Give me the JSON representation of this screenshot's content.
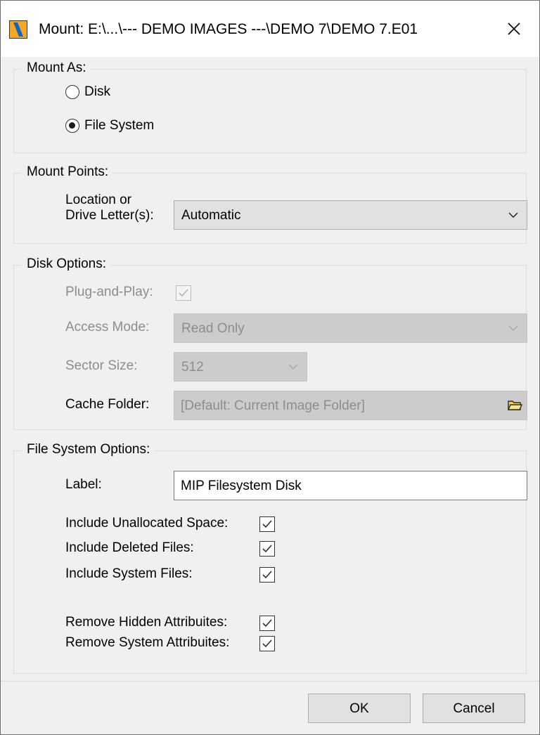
{
  "window": {
    "title": "Mount: E:\\...\\--- DEMO IMAGES ---\\DEMO 7\\DEMO 7.E01",
    "icons": {
      "app": "mount-app-icon",
      "close": "close-icon"
    }
  },
  "mount_as": {
    "label": "Mount As:",
    "options": [
      {
        "label": "Disk",
        "selected": false
      },
      {
        "label": "File System",
        "selected": true
      }
    ]
  },
  "mount_points": {
    "label": "Mount Points:",
    "location_label_line1": "Location or",
    "location_label_line2": "Drive Letter(s):",
    "location_value": "Automatic"
  },
  "disk_options": {
    "label": "Disk Options:",
    "plug_and_play_label": "Plug-and-Play:",
    "plug_and_play_checked": true,
    "access_mode_label": "Access Mode:",
    "access_mode_value": "Read Only",
    "sector_size_label": "Sector Size:",
    "sector_size_value": "512",
    "cache_folder_label": "Cache Folder:",
    "cache_folder_value": "[Default: Current Image Folder]",
    "cache_folder_icon": "folder-icon"
  },
  "fs_options": {
    "label": "File System Options:",
    "label_label": "Label:",
    "label_value": "MIP Filesystem Disk",
    "checks": [
      {
        "label": "Include Unallocated Space:",
        "checked": true
      },
      {
        "label": "Include Deleted Files:",
        "checked": true
      },
      {
        "label": "Include System Files:",
        "checked": true
      },
      {
        "label": "Remove Hidden Attribuites:",
        "checked": true
      },
      {
        "label": "Remove System Attribuites:",
        "checked": true
      }
    ]
  },
  "buttons": {
    "ok": "OK",
    "cancel": "Cancel"
  },
  "colors": {
    "dialog_bg": "#f0f0f0",
    "titlebar_bg": "#ffffff",
    "disabled_text": "#8d8d8d",
    "disabled_field": "#cccccc",
    "icon_orange": "#f5a623",
    "icon_blue": "#1565c0"
  }
}
